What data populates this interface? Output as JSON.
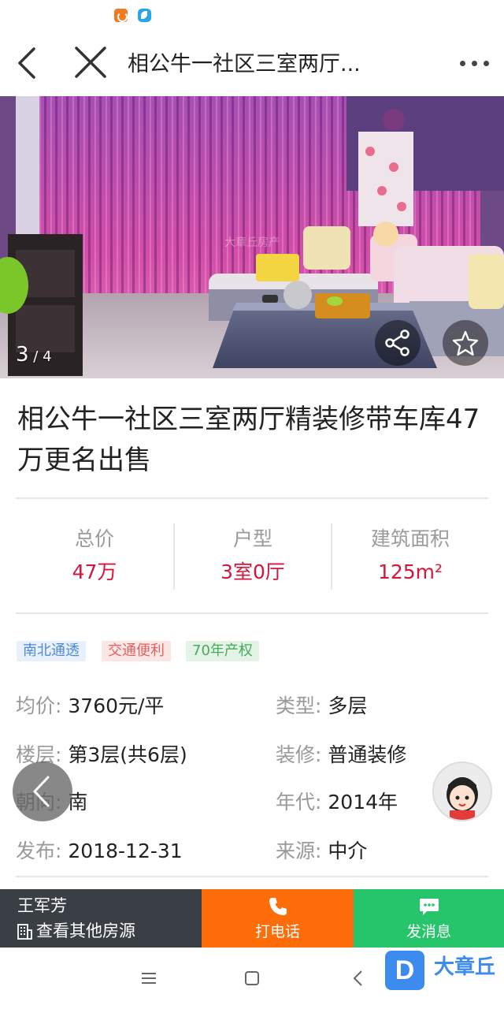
{
  "navbar": {
    "title": "相公牛一社区三室两厅..."
  },
  "photo": {
    "current": "3",
    "separator": " / ",
    "total": "4",
    "watermark": "大章丘房产"
  },
  "listing": {
    "title": "相公牛一社区三室两厅精装修带车库47万更名出售"
  },
  "stats": [
    {
      "label": "总价",
      "value": "47万"
    },
    {
      "label": "户型",
      "value": "3室0厅"
    },
    {
      "label": "建筑面积",
      "value": "125m²"
    }
  ],
  "tags": [
    "南北通透",
    "交通便利",
    "70年产权"
  ],
  "details": [
    {
      "key": "均价",
      "value": "3760元/平"
    },
    {
      "key": "类型",
      "value": "多层"
    },
    {
      "key": "楼层",
      "value": "第3层(共6层)"
    },
    {
      "key": "装修",
      "value": "普通装修"
    },
    {
      "key": "朝向",
      "value": "南"
    },
    {
      "key": "年代",
      "value": "2014年"
    },
    {
      "key": "发布",
      "value": "2018-12-31"
    },
    {
      "key": "来源",
      "value": "中介"
    }
  ],
  "details_separator": ": ",
  "bottom_bar": {
    "agent_name": "王军芳",
    "other_listings": "查看其他房源",
    "call_label": "打电话",
    "message_label": "发消息"
  },
  "branding": {
    "logo_letter": "D",
    "name": "大章丘"
  },
  "colors": {
    "price_red": "#d4163c",
    "call_orange": "#ff6d0a",
    "message_green": "#27c56b",
    "agent_dark": "#3a3f45",
    "brand_blue": "#3d8bef"
  },
  "icons": {
    "back": "chevron-left-icon",
    "close": "close-icon",
    "more": "more-dots-icon",
    "share": "share-icon",
    "favorite": "star-icon",
    "building": "building-icon",
    "phone": "phone-icon",
    "message": "chat-bubble-icon",
    "avatar": "cartoon-avatar-icon"
  }
}
